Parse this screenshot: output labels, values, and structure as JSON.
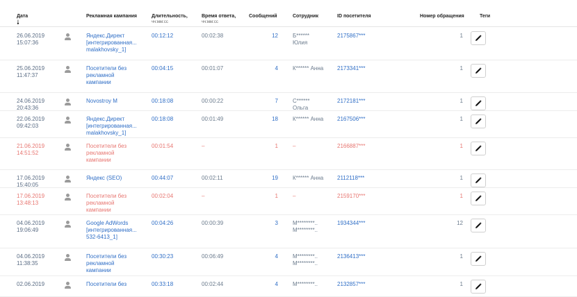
{
  "columns": {
    "date": "Дата",
    "campaign": "Рекламная кампания",
    "duration": "Длительность,",
    "duration_unit": "чч:мм:сс",
    "response": "Время ответа,",
    "response_unit": "чч:мм:сс",
    "messages": "Сообщений",
    "employee": "Сотрудник",
    "visitor_id": "ID посетителя",
    "request_number": "Номер обращения",
    "tags": "Теги"
  },
  "sort_indicator": "🠗",
  "colors": {
    "link": "#2f6ec6",
    "missed": "#e77570",
    "text": "#6a7a8c"
  },
  "rows": [
    {
      "date": "26.06.2019",
      "time": "15:07:36",
      "campaign": [
        "Яндекс.Директ",
        "[интегрированная...",
        "malakhovsky_1]"
      ],
      "duration": "00:12:12",
      "response": "00:02:38",
      "messages": "12",
      "employee": [
        "Б******",
        "Юлия"
      ],
      "visitor_id": "2175867***",
      "request_number": "1",
      "missed": false
    },
    {
      "date": "25.06.2019",
      "time": "11:47:37",
      "campaign": [
        "Посетители без",
        "рекламной",
        "кампании"
      ],
      "duration": "00:04:15",
      "response": "00:01:07",
      "messages": "4",
      "employee": [
        "К****** Анна"
      ],
      "visitor_id": "2173341***",
      "request_number": "1",
      "missed": false
    },
    {
      "date": "24.06.2019",
      "time": "20:43:36",
      "campaign": [
        "Novostroy M"
      ],
      "duration": "00:18:08",
      "response": "00:00:22",
      "messages": "7",
      "employee": [
        "С******",
        "Ольга"
      ],
      "visitor_id": "2172181***",
      "request_number": "1",
      "missed": false
    },
    {
      "date": "22.06.2019",
      "time": "09:42:03",
      "campaign": [
        "Яндекс.Директ",
        "[интегрированная...",
        "malakhovsky_1]"
      ],
      "duration": "00:18:08",
      "response": "00:01:49",
      "messages": "18",
      "employee": [
        "К****** Анна"
      ],
      "visitor_id": "2167506***",
      "request_number": "1",
      "missed": false
    },
    {
      "date": "21.06.2019",
      "time": "14:51:52",
      "campaign": [
        "Посетители без",
        "рекламной",
        "кампании"
      ],
      "duration": "00:01:54",
      "response": "–",
      "messages": "1",
      "employee": [
        "–"
      ],
      "visitor_id": "2166887***",
      "request_number": "1",
      "missed": true
    },
    {
      "date": "17.06.2019",
      "time": "15:40:05",
      "campaign": [
        "Яндекс (SEO)"
      ],
      "duration": "00:44:07",
      "response": "00:02:11",
      "messages": "19",
      "employee": [
        "К****** Анна"
      ],
      "visitor_id": "2112118***",
      "request_number": "1",
      "missed": false
    },
    {
      "date": "17.06.2019",
      "time": "13:48:13",
      "campaign": [
        "Посетители без",
        "рекламной",
        "кампании"
      ],
      "duration": "00:02:04",
      "response": "–",
      "messages": "1",
      "employee": [
        "–"
      ],
      "visitor_id": "2159170***",
      "request_number": "1",
      "missed": true
    },
    {
      "date": "04.06.2019",
      "time": "19:06:49",
      "campaign": [
        "Google AdWords",
        "[интегрированная...",
        "532-6413_1]"
      ],
      "duration": "00:04:26",
      "response": "00:00:39",
      "messages": "3",
      "employee": [
        "М********..",
        "М********.."
      ],
      "visitor_id": "1934344***",
      "request_number": "12",
      "missed": false
    },
    {
      "date": "04.06.2019",
      "time": "11:38:35",
      "campaign": [
        "Посетители без",
        "рекламной",
        "кампании"
      ],
      "duration": "00:30:23",
      "response": "00:06:49",
      "messages": "4",
      "employee": [
        "М********..",
        "М********.."
      ],
      "visitor_id": "2136413***",
      "request_number": "1",
      "missed": false
    },
    {
      "date": "02.06.2019",
      "time": "",
      "campaign": [
        "Посетители без"
      ],
      "duration": "00:33:18",
      "response": "00:02:44",
      "messages": "4",
      "employee": [
        "М********.."
      ],
      "visitor_id": "2132857***",
      "request_number": "1",
      "missed": false
    }
  ]
}
